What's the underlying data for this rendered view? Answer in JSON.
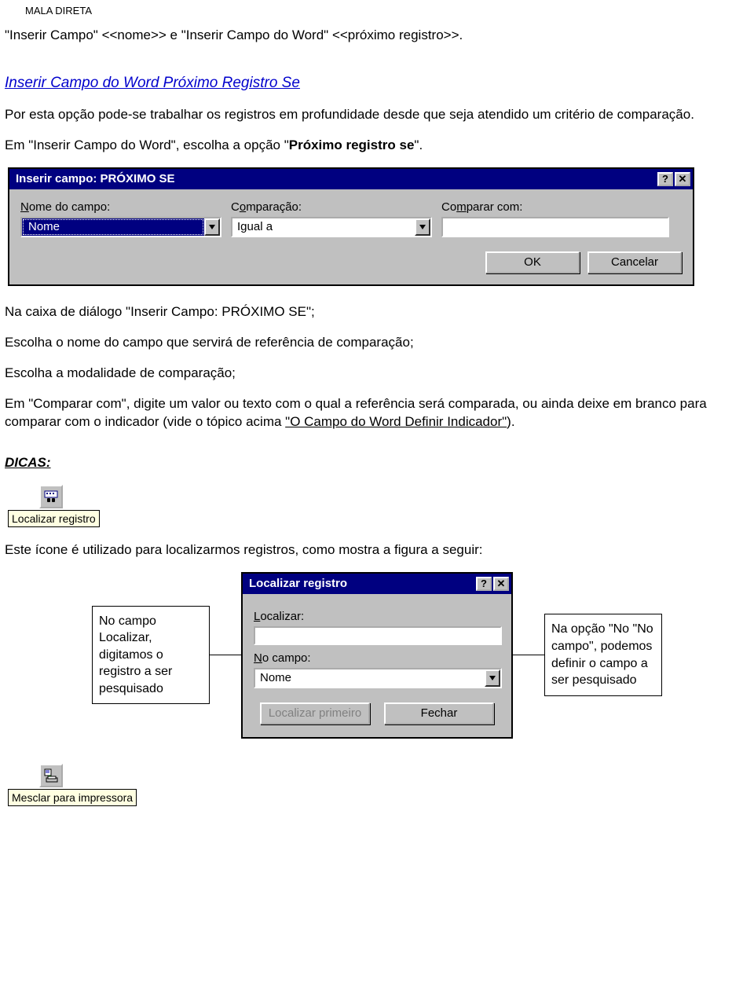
{
  "header": {
    "mala": "MALA DIRETA"
  },
  "line1": {
    "pre": "\"Inserir Campo\" ",
    "field1": "<<nome>>",
    "mid": " e \"Inserir Campo do Word\" ",
    "field2": "<<próximo registro>>",
    "post": "."
  },
  "heading": "Inserir Campo do Word Próximo Registro Se",
  "p1": "Por esta opção pode-se trabalhar os registros em profundidade desde que seja atendido um critério de comparação.",
  "p2_pre": "Em \"Inserir Campo do Word\", escolha a opção \"",
  "p2_strong": "Próximo registro se",
  "p2_post": "\".",
  "dialog1": {
    "title": "Inserir campo: PRÓXIMO SE",
    "labels": {
      "nome": "Nome do campo:",
      "comparacao": "Comparação:",
      "comparar": "Comparar com:"
    },
    "values": {
      "nome": "Nome",
      "comparacao": "Igual a",
      "comparar": ""
    },
    "buttons": {
      "ok": "OK",
      "cancel": "Cancelar"
    }
  },
  "p3": "Na caixa de diálogo \"Inserir Campo: PRÓXIMO SE\";",
  "p4": "Escolha o nome do campo que servirá de referência de comparação;",
  "p5": "Escolha a modalidade de comparação;",
  "p6_pre": "Em \"Comparar com\", digite um valor ou texto com o qual a referência será comparada, ou ainda deixe em branco para comparar com o indicador (vide o tópico acima ",
  "p6_link": "\"O Campo do Word Definir Indicador\"",
  "p6_post": ").",
  "dicas": "DICAS:",
  "toolbutton1": {
    "tooltip": "Localizar registro"
  },
  "p7": "Este ícone é utilizado para localizarmos registros, como mostra a figura a seguir:",
  "note_left": "No campo Localizar, digitamos o registro a ser pesquisado",
  "note_right": "Na opção \"No \"No campo\", podemos definir o campo a ser pesquisado",
  "dialog2": {
    "title": "Localizar registro",
    "labels": {
      "localizar": "Localizar:",
      "nocampo": "No campo:"
    },
    "values": {
      "localizar": "",
      "nocampo": "Nome"
    },
    "buttons": {
      "first": "Localizar primeiro",
      "close": "Fechar"
    }
  },
  "toolbutton2": {
    "tooltip": "Mesclar para impressora"
  }
}
